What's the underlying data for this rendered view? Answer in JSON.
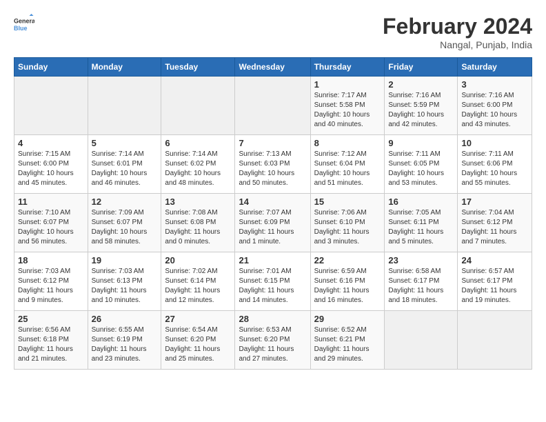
{
  "header": {
    "logo_line1": "General",
    "logo_line2": "Blue",
    "month_year": "February 2024",
    "location": "Nangal, Punjab, India"
  },
  "weekdays": [
    "Sunday",
    "Monday",
    "Tuesday",
    "Wednesday",
    "Thursday",
    "Friday",
    "Saturday"
  ],
  "weeks": [
    [
      {
        "day": "",
        "info": ""
      },
      {
        "day": "",
        "info": ""
      },
      {
        "day": "",
        "info": ""
      },
      {
        "day": "",
        "info": ""
      },
      {
        "day": "1",
        "info": "Sunrise: 7:17 AM\nSunset: 5:58 PM\nDaylight: 10 hours\nand 40 minutes."
      },
      {
        "day": "2",
        "info": "Sunrise: 7:16 AM\nSunset: 5:59 PM\nDaylight: 10 hours\nand 42 minutes."
      },
      {
        "day": "3",
        "info": "Sunrise: 7:16 AM\nSunset: 6:00 PM\nDaylight: 10 hours\nand 43 minutes."
      }
    ],
    [
      {
        "day": "4",
        "info": "Sunrise: 7:15 AM\nSunset: 6:00 PM\nDaylight: 10 hours\nand 45 minutes."
      },
      {
        "day": "5",
        "info": "Sunrise: 7:14 AM\nSunset: 6:01 PM\nDaylight: 10 hours\nand 46 minutes."
      },
      {
        "day": "6",
        "info": "Sunrise: 7:14 AM\nSunset: 6:02 PM\nDaylight: 10 hours\nand 48 minutes."
      },
      {
        "day": "7",
        "info": "Sunrise: 7:13 AM\nSunset: 6:03 PM\nDaylight: 10 hours\nand 50 minutes."
      },
      {
        "day": "8",
        "info": "Sunrise: 7:12 AM\nSunset: 6:04 PM\nDaylight: 10 hours\nand 51 minutes."
      },
      {
        "day": "9",
        "info": "Sunrise: 7:11 AM\nSunset: 6:05 PM\nDaylight: 10 hours\nand 53 minutes."
      },
      {
        "day": "10",
        "info": "Sunrise: 7:11 AM\nSunset: 6:06 PM\nDaylight: 10 hours\nand 55 minutes."
      }
    ],
    [
      {
        "day": "11",
        "info": "Sunrise: 7:10 AM\nSunset: 6:07 PM\nDaylight: 10 hours\nand 56 minutes."
      },
      {
        "day": "12",
        "info": "Sunrise: 7:09 AM\nSunset: 6:07 PM\nDaylight: 10 hours\nand 58 minutes."
      },
      {
        "day": "13",
        "info": "Sunrise: 7:08 AM\nSunset: 6:08 PM\nDaylight: 11 hours\nand 0 minutes."
      },
      {
        "day": "14",
        "info": "Sunrise: 7:07 AM\nSunset: 6:09 PM\nDaylight: 11 hours\nand 1 minute."
      },
      {
        "day": "15",
        "info": "Sunrise: 7:06 AM\nSunset: 6:10 PM\nDaylight: 11 hours\nand 3 minutes."
      },
      {
        "day": "16",
        "info": "Sunrise: 7:05 AM\nSunset: 6:11 PM\nDaylight: 11 hours\nand 5 minutes."
      },
      {
        "day": "17",
        "info": "Sunrise: 7:04 AM\nSunset: 6:12 PM\nDaylight: 11 hours\nand 7 minutes."
      }
    ],
    [
      {
        "day": "18",
        "info": "Sunrise: 7:03 AM\nSunset: 6:12 PM\nDaylight: 11 hours\nand 9 minutes."
      },
      {
        "day": "19",
        "info": "Sunrise: 7:03 AM\nSunset: 6:13 PM\nDaylight: 11 hours\nand 10 minutes."
      },
      {
        "day": "20",
        "info": "Sunrise: 7:02 AM\nSunset: 6:14 PM\nDaylight: 11 hours\nand 12 minutes."
      },
      {
        "day": "21",
        "info": "Sunrise: 7:01 AM\nSunset: 6:15 PM\nDaylight: 11 hours\nand 14 minutes."
      },
      {
        "day": "22",
        "info": "Sunrise: 6:59 AM\nSunset: 6:16 PM\nDaylight: 11 hours\nand 16 minutes."
      },
      {
        "day": "23",
        "info": "Sunrise: 6:58 AM\nSunset: 6:17 PM\nDaylight: 11 hours\nand 18 minutes."
      },
      {
        "day": "24",
        "info": "Sunrise: 6:57 AM\nSunset: 6:17 PM\nDaylight: 11 hours\nand 19 minutes."
      }
    ],
    [
      {
        "day": "25",
        "info": "Sunrise: 6:56 AM\nSunset: 6:18 PM\nDaylight: 11 hours\nand 21 minutes."
      },
      {
        "day": "26",
        "info": "Sunrise: 6:55 AM\nSunset: 6:19 PM\nDaylight: 11 hours\nand 23 minutes."
      },
      {
        "day": "27",
        "info": "Sunrise: 6:54 AM\nSunset: 6:20 PM\nDaylight: 11 hours\nand 25 minutes."
      },
      {
        "day": "28",
        "info": "Sunrise: 6:53 AM\nSunset: 6:20 PM\nDaylight: 11 hours\nand 27 minutes."
      },
      {
        "day": "29",
        "info": "Sunrise: 6:52 AM\nSunset: 6:21 PM\nDaylight: 11 hours\nand 29 minutes."
      },
      {
        "day": "",
        "info": ""
      },
      {
        "day": "",
        "info": ""
      }
    ]
  ]
}
